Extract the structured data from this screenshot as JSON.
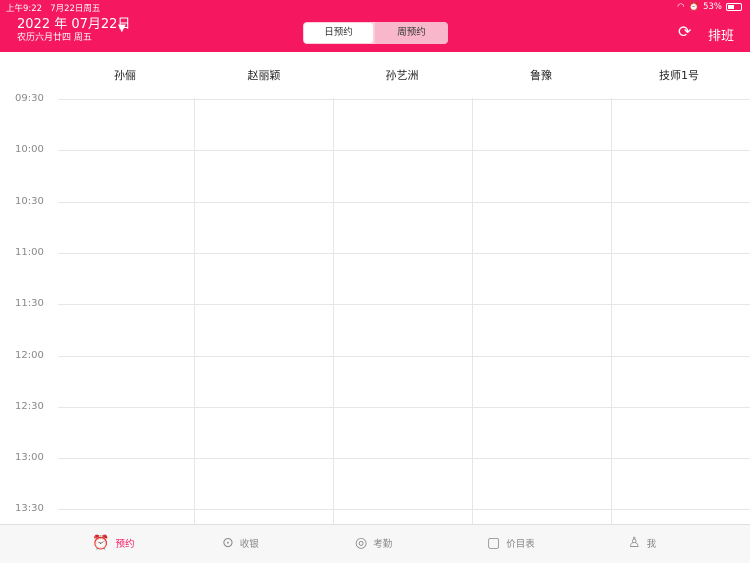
{
  "status_bar": {
    "time": "上午9:22",
    "date": "7月22日周五",
    "battery": "53%"
  },
  "header": {
    "date": "2022 年 07月22日",
    "lunar": "农历六月廿四   周五",
    "segments": {
      "day": "日预约",
      "week": "周预约",
      "active": "day"
    },
    "schedule_label": "排班",
    "icons": {
      "refresh": "refresh-icon",
      "dropdown": "caret-down-icon"
    },
    "accent_color": "#f5175f"
  },
  "staff": [
    "孙俪",
    "赵丽颖",
    "孙艺洲",
    "鲁豫",
    "技师1号"
  ],
  "times": [
    "09:30",
    "10:00",
    "10:30",
    "11:00",
    "11:30",
    "12:00",
    "12:30",
    "13:00",
    "13:30"
  ],
  "tabbar": {
    "active": 0,
    "items": [
      {
        "label": "预约",
        "icon": "alarm-clock-icon"
      },
      {
        "label": "收银",
        "icon": "yen-icon"
      },
      {
        "label": "考勤",
        "icon": "location-pin-icon"
      },
      {
        "label": "价目表",
        "icon": "clipboard-icon"
      },
      {
        "label": "我",
        "icon": "person-icon"
      }
    ]
  }
}
